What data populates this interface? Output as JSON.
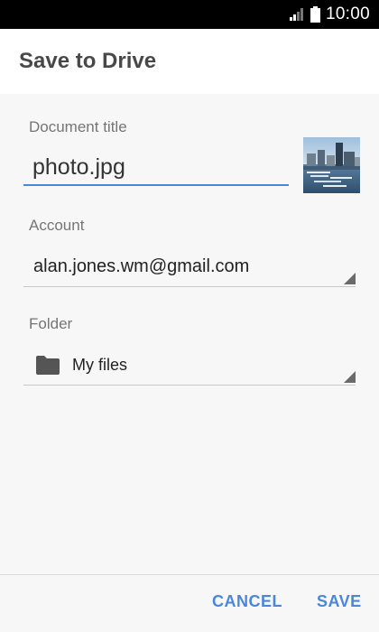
{
  "status_bar": {
    "time": "10:00",
    "icons": [
      "signal-icon",
      "battery-icon"
    ]
  },
  "header": {
    "title": "Save to Drive"
  },
  "form": {
    "document_title": {
      "label": "Document title",
      "value": "photo.jpg"
    },
    "account": {
      "label": "Account",
      "value": "alan.jones.wm@gmail.com"
    },
    "folder": {
      "label": "Folder",
      "value": "My files",
      "icon": "folder-icon"
    }
  },
  "footer": {
    "cancel_label": "CANCEL",
    "save_label": "SAVE"
  },
  "colors": {
    "accent": "#4a86d9",
    "status_bar": "#000000",
    "header_bg": "#ffffff",
    "body_bg": "#f7f7f7",
    "label": "#757575"
  }
}
